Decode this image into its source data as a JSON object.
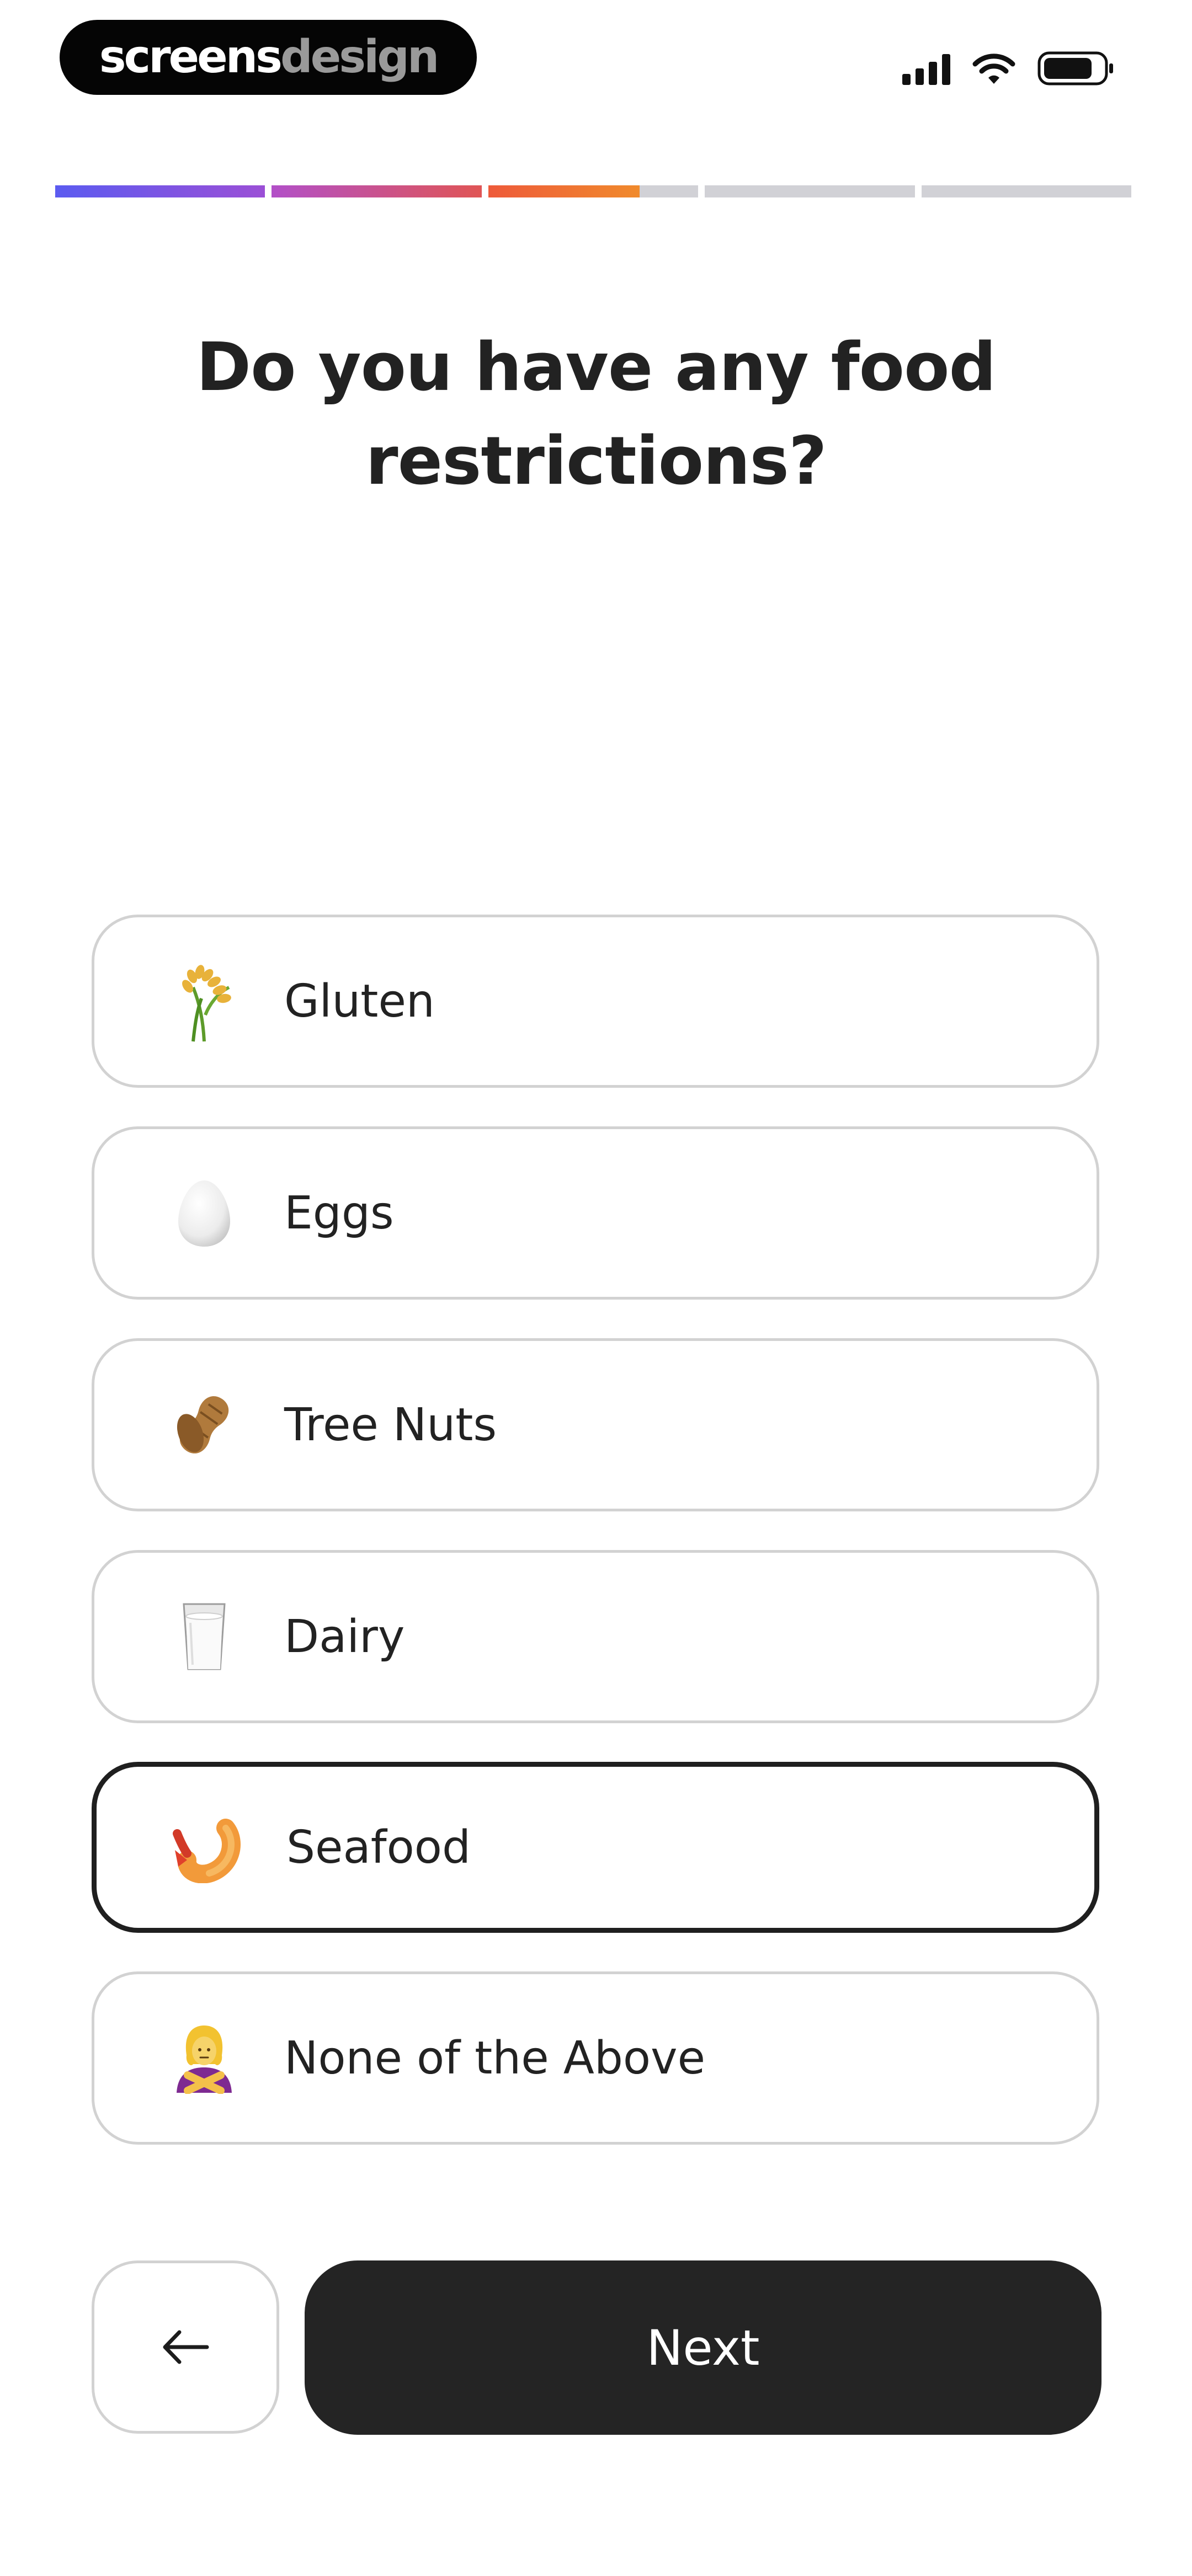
{
  "status_bar": {
    "brand_part1": "screens",
    "brand_part2": "design",
    "signal_icon": "cellular-signal-icon",
    "wifi_icon": "wifi-icon",
    "battery_icon": "battery-icon"
  },
  "progress": {
    "total_steps": 5,
    "segments": [
      {
        "fill": 1.0,
        "colors": [
          "#5b5bf0",
          "#9b4fd6"
        ]
      },
      {
        "fill": 1.0,
        "colors": [
          "#b24fc8",
          "#e05555"
        ]
      },
      {
        "fill": 0.72,
        "colors": [
          "#ee5a3a",
          "#f08a2c"
        ]
      },
      {
        "fill": 0.0,
        "colors": []
      },
      {
        "fill": 0.0,
        "colors": []
      }
    ],
    "track_color": "#d1d1d6"
  },
  "question": {
    "line1": "Do you have any food",
    "line2": "restrictions?"
  },
  "options": [
    {
      "label": "Gluten",
      "icon": "rice-plant-icon",
      "selected": false
    },
    {
      "label": "Eggs",
      "icon": "egg-icon",
      "selected": false
    },
    {
      "label": "Tree Nuts",
      "icon": "peanut-icon",
      "selected": false
    },
    {
      "label": "Dairy",
      "icon": "milk-glass-icon",
      "selected": false
    },
    {
      "label": "Seafood",
      "icon": "shrimp-icon",
      "selected": true
    },
    {
      "label": "None of the Above",
      "icon": "person-gesturing-no-icon",
      "selected": false
    }
  ],
  "buttons": {
    "back_icon": "arrow-left-icon",
    "next_label": "Next"
  },
  "colors": {
    "accent": "#242424",
    "border": "#d2d2d2",
    "selected_border": "#1f1f1f"
  }
}
